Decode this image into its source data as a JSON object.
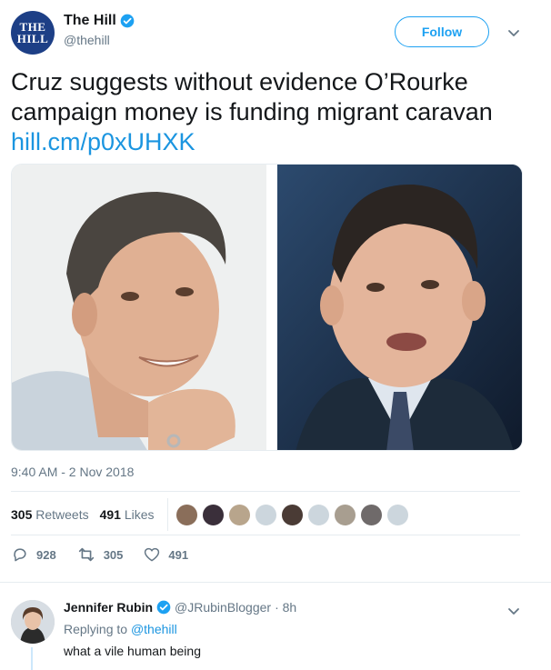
{
  "account": {
    "avatar_line1": "THE",
    "avatar_line2": "HILL",
    "display_name": "The Hill",
    "handle": "@thehill",
    "follow_label": "Follow"
  },
  "tweet": {
    "text": "Cruz suggests without evidence O’Rourke campaign money is funding migrant caravan",
    "link": "hill.cm/p0xUHXK",
    "timestamp": "9:40 AM - 2 Nov 2018"
  },
  "stats": {
    "retweets_count": "305",
    "retweets_label": "Retweets",
    "likes_count": "491",
    "likes_label": "Likes"
  },
  "actions": {
    "reply_count": "928",
    "retweet_count": "305",
    "like_count": "491"
  },
  "reply": {
    "name": "Jennifer Rubin",
    "handle": "@JRubinBlogger",
    "time": "· 8h",
    "replying_prefix": "Replying to",
    "replying_to": "@thehill",
    "text": "what a vile human being"
  },
  "colors": {
    "accent": "#1da1f2",
    "link": "#1b95e0",
    "muted": "#657786",
    "brand_hill": "#1d3f86"
  },
  "icons": {
    "verified": "verified-badge-icon",
    "caret": "chevron-down-icon",
    "reply": "reply-icon",
    "retweet": "retweet-icon",
    "like": "heart-icon"
  }
}
